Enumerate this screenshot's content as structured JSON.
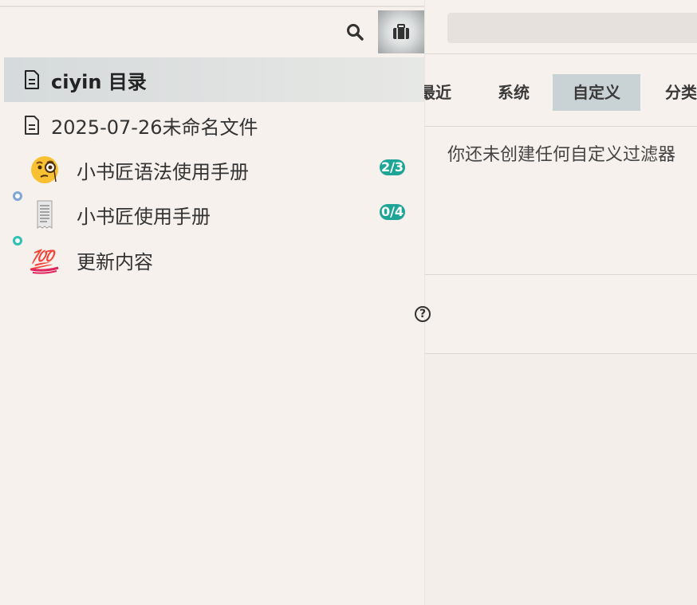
{
  "sidebar": {
    "items": [
      {
        "label": "ciyin 目录"
      },
      {
        "label": "2025-07-26未命名文件"
      },
      {
        "label": "小书匠语法使用手册",
        "badge": "2/3"
      },
      {
        "label": "小书匠使用手册",
        "badge": "0/4"
      },
      {
        "label": "更新内容",
        "emoji": "💯"
      }
    ]
  },
  "right_panel": {
    "tabs": [
      "最近",
      "系统",
      "自定义",
      "分类"
    ],
    "active_tab": "自定义",
    "empty_message": "你还未创建任何自定义过滤器"
  },
  "icons": {
    "help": "?"
  },
  "colors": {
    "badge": "#1ea596",
    "selected_tab": "#c9d2d4",
    "dot_blue": "#7ea6d6",
    "dot_teal": "#2ec0b2"
  }
}
